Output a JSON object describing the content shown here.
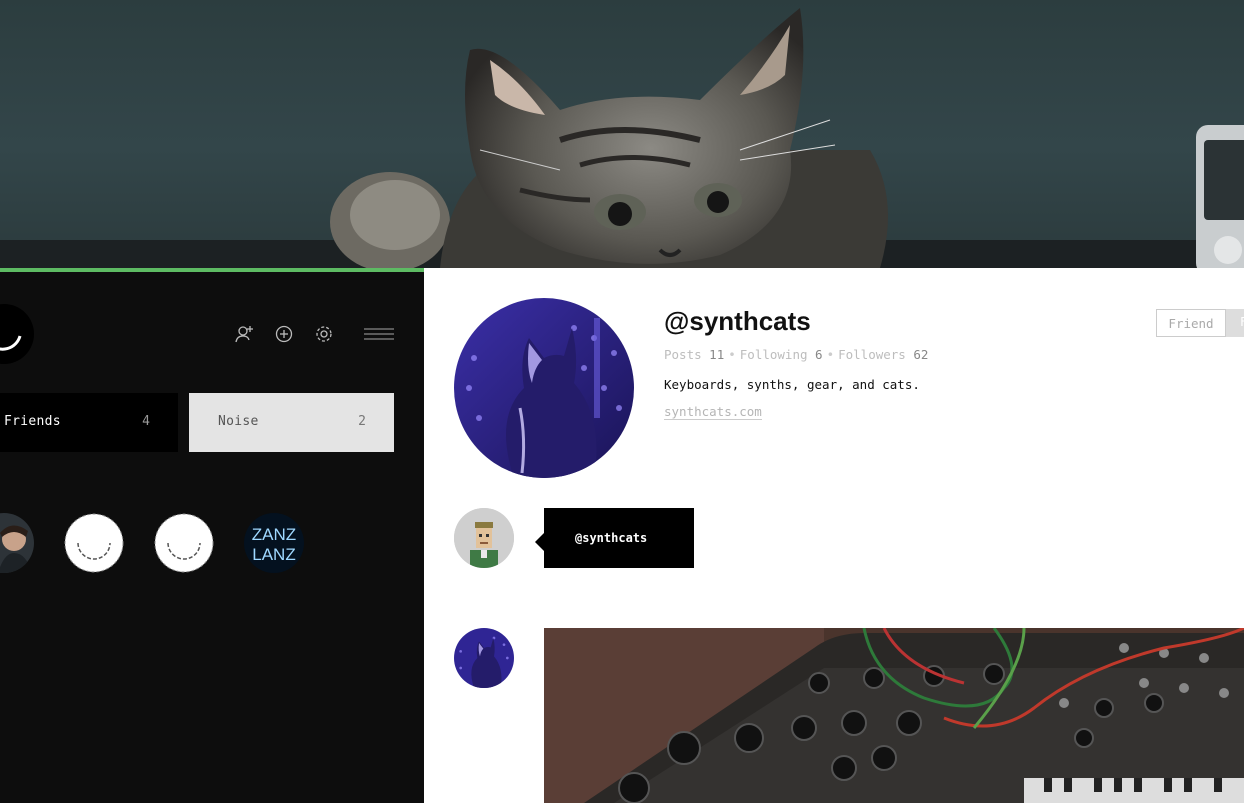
{
  "cover": {
    "accent_color": "#5dbb63"
  },
  "sidebar": {
    "tabs": [
      {
        "label": "Friends",
        "count": "4"
      },
      {
        "label": "Noise",
        "count": "2"
      }
    ],
    "toolbar_icons": [
      "add-friend-icon",
      "plus-circle-icon",
      "settings-gear-icon",
      "menu-icon"
    ],
    "friend_avatar_text": [
      "ZANZ",
      "LANZ"
    ]
  },
  "profile": {
    "username": "@synthcats",
    "stats": {
      "posts_label": "Posts",
      "posts": "11",
      "following_label": "Following",
      "following": "6",
      "followers_label": "Followers",
      "followers": "62"
    },
    "bio": "Keyboards, synths, gear, and cats.",
    "website": "synthcats.com",
    "friend_button": "Friend",
    "follow_button_partial": "F"
  },
  "feed": {
    "mention": "@synthcats"
  }
}
